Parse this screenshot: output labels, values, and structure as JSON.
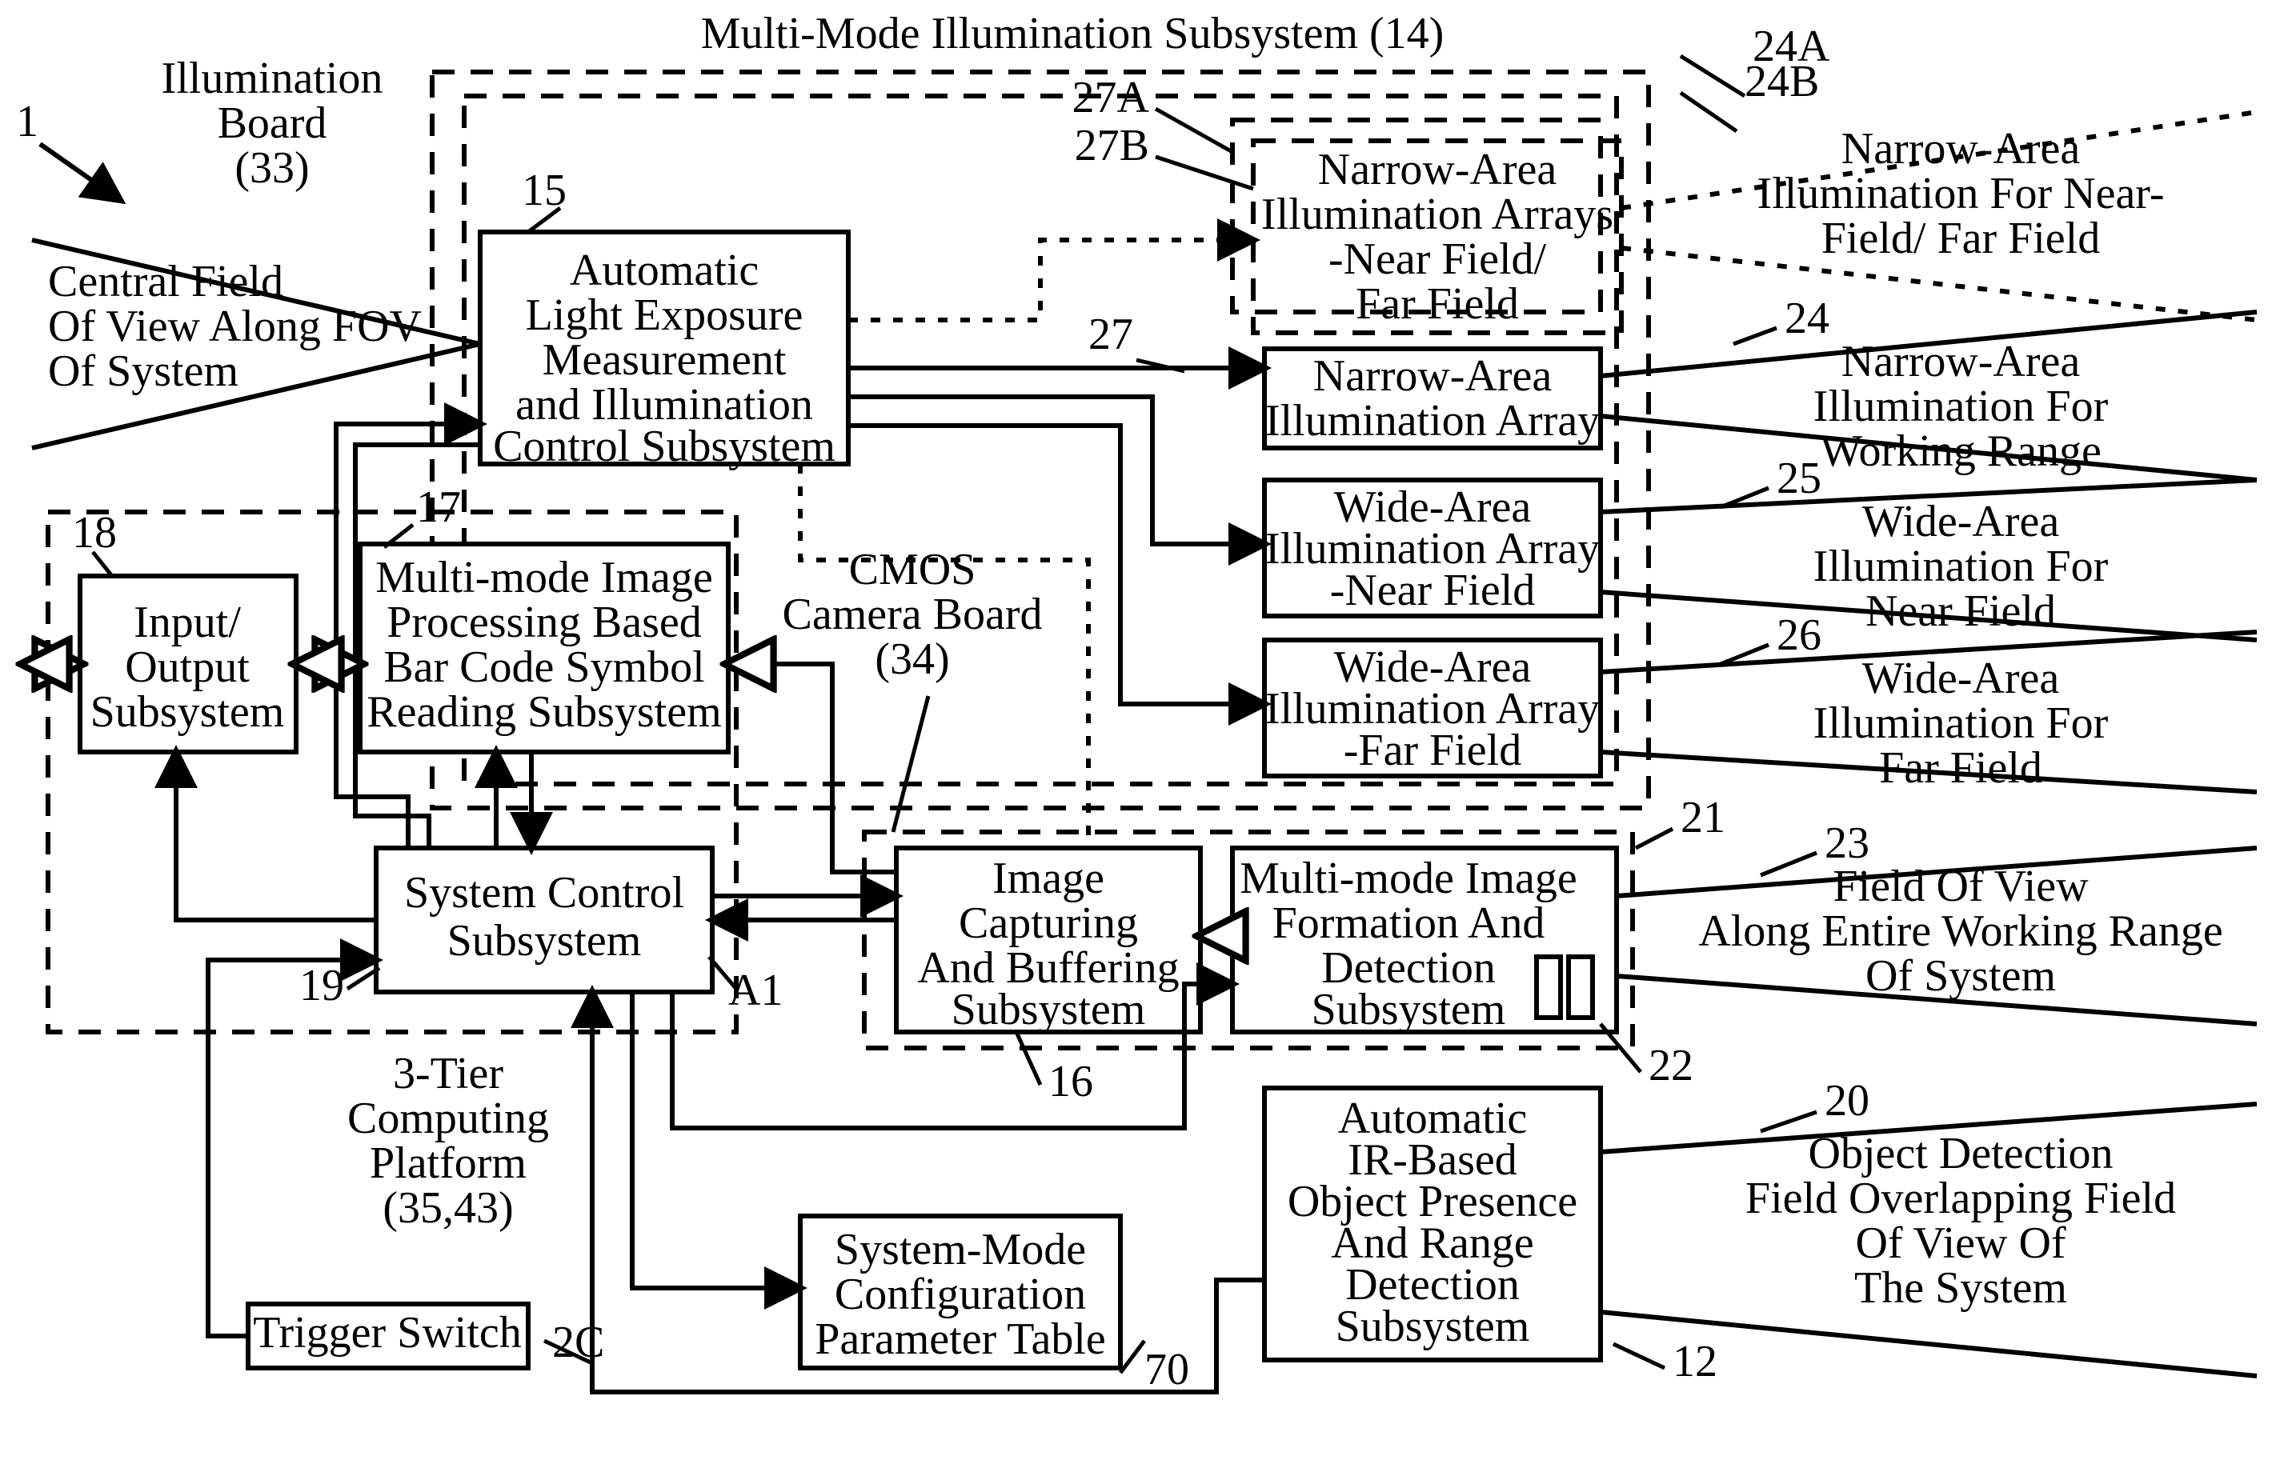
{
  "title_subsystem": "Multi-Mode Illumination Subsystem (14)",
  "refs": {
    "r1": "1",
    "r33_a": "Illumination",
    "r33_b": "Board",
    "r33_c": "(33)",
    "r15": "15",
    "r27A": "27A",
    "r27B": "27B",
    "r24A": "24A",
    "r24B": "24B",
    "r27": "27",
    "r24": "24",
    "r25": "25",
    "r26": "26",
    "r17": "17",
    "r18": "18",
    "r19": "19",
    "rA1": "A1",
    "r16": "16",
    "r21": "21",
    "r22": "22",
    "r23": "23",
    "r12": "12",
    "r20": "20",
    "r70": "70",
    "r2C": "2C",
    "r34_a": "CMOS",
    "r34_b": "Camera Board",
    "r34_c": "(34)",
    "r35_a": "3-Tier",
    "r35_b": "Computing",
    "r35_c": "Platform",
    "r35_d": "(35,43)"
  },
  "cfov_a": "Central Field",
  "cfov_b": "Of View Along FOV",
  "cfov_c": "Of System",
  "box15_a": "Automatic",
  "box15_b": "Light Exposure",
  "box15_c": "Measurement",
  "box15_d": "and Illumination",
  "box15_e": "Control Subsystem",
  "box27AB_a": "Narrow-Area",
  "box27AB_b": "Illumination Arrays",
  "box27AB_c": "-Near Field/",
  "box27AB_d": "Far Field",
  "box27_a": "Narrow-Area",
  "box27_b": "Illumination Array",
  "box28_a": "Wide-Area",
  "box28_b": "Illumination Array",
  "box28_c": "-Near Field",
  "box29_a": "Wide-Area",
  "box29_b": "Illumination Array",
  "box29_c": "-Far Field",
  "out24AB_a": "Narrow-Area",
  "out24AB_b": "Illumination For Near-",
  "out24AB_c": "Field/ Far Field",
  "out24_a": "Narrow-Area",
  "out24_b": "Illumination For",
  "out24_c": "Working Range",
  "out25_a": "Wide-Area",
  "out25_b": "Illumination For",
  "out25_c": "Near Field",
  "out26_a": "Wide-Area",
  "out26_b": "Illumination For",
  "out26_c": "Far Field",
  "box18_a": "Input/",
  "box18_b": "Output",
  "box18_c": "Subsystem",
  "box17_a": "Multi-mode Image",
  "box17_b": "Processing Based",
  "box17_c": "Bar Code Symbol",
  "box17_d": "Reading Subsystem",
  "box19_a": "System Control",
  "box19_b": "Subsystem",
  "box16_a": "Image",
  "box16_b": "Capturing",
  "box16_c": "And Buffering",
  "box16_d": "Subsystem",
  "box21_a": "Multi-mode Image",
  "box21_b": "Formation And",
  "box21_c": "Detection",
  "box21_d": "Subsystem",
  "out23_a": "Field Of View",
  "out23_b": "Along Entire Working Range",
  "out23_c": "Of System",
  "box12_a": "Automatic",
  "box12_b": "IR-Based",
  "box12_c": "Object Presence",
  "box12_d": "And Range",
  "box12_e": "Detection",
  "box12_f": "Subsystem",
  "out20_a": "Object Detection",
  "out20_b": "Field Overlapping Field",
  "out20_c": "Of View Of",
  "out20_d": "The System",
  "box70_a": "System-Mode",
  "box70_b": "Configuration",
  "box70_c": "Parameter Table",
  "trigger": "Trigger Switch"
}
